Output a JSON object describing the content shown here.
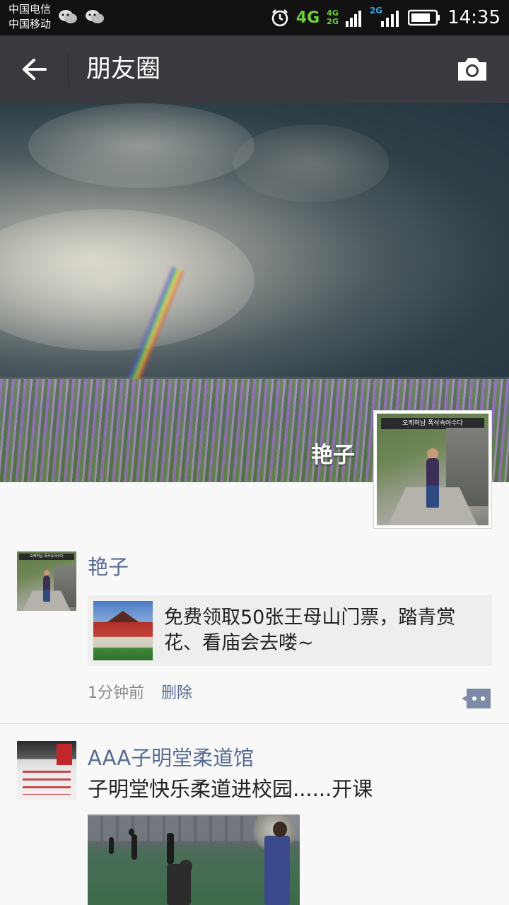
{
  "status_bar": {
    "carrier_1": "中国电信",
    "carrier_2": "中国移动",
    "network_main": "4G",
    "network_small_top": "4G",
    "network_small_bottom": "2G",
    "network_secondary": "2G",
    "time": "14:35",
    "icons": [
      "wechat-icon",
      "wechat-icon",
      "alarm-icon",
      "signal-icon",
      "battery-icon"
    ]
  },
  "header": {
    "title": "朋友圈",
    "back_icon": "arrow-left-icon",
    "camera_icon": "camera-icon",
    "background": "#393a3f"
  },
  "cover": {
    "profile_name": "艳子",
    "avatar_sign_text": "오케허남   폭삭속아수다"
  },
  "posts": [
    {
      "author": "艳子",
      "share_text": "免费领取50张王母山门票，踏青赏花、看庙会去喽~",
      "time_ago": "1分钟前",
      "delete_label": "删除",
      "comment_icon": "comment-bubble-icon"
    },
    {
      "author": "AAA子明堂柔道馆",
      "text": "子明堂快乐柔道进校园......开课"
    }
  ],
  "colors": {
    "link": "#576b95",
    "titlebar": "#393a3f",
    "feed_bg": "#f8f8f8"
  }
}
